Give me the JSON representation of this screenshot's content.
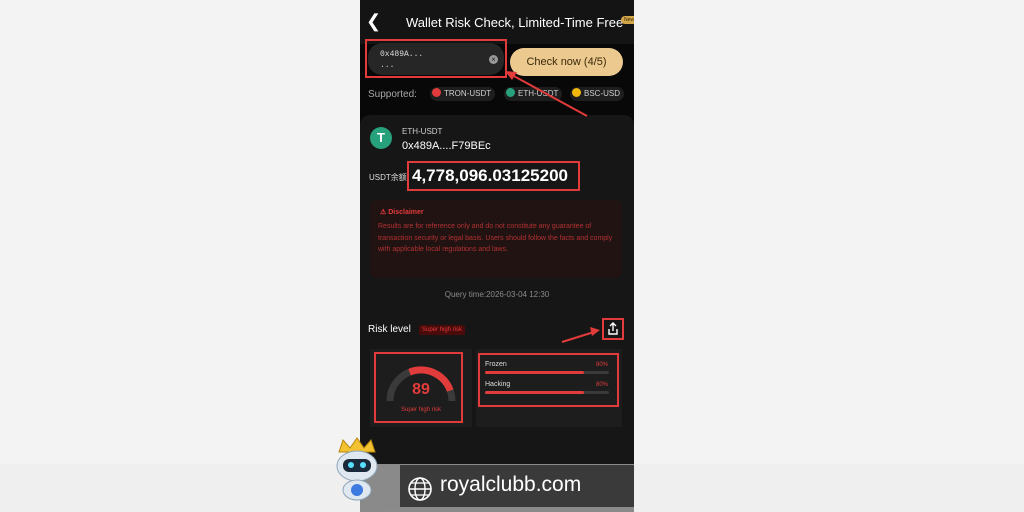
{
  "header": {
    "title": "Wallet Risk Check, Limited-Time Free",
    "badge": "New",
    "back_icon": "chevron-left-icon"
  },
  "search": {
    "address_line1": "0x489A...",
    "address_line2": "...",
    "check_label": "Check now (4/5)"
  },
  "supported": {
    "label": "Supported:",
    "chains": [
      {
        "label": "TRON-USDT",
        "color": "#e23b3b"
      },
      {
        "label": "ETH-USDT",
        "color": "#26a17b"
      },
      {
        "label": "BSC-USD",
        "color": "#f0b90b"
      }
    ]
  },
  "token": {
    "name": "ETH-USDT",
    "address": "0x489A....F79BEc",
    "balance_label": "USDT余额",
    "balance": "4,778,096.03125200"
  },
  "disclaimer": {
    "title": "Disclaimer",
    "body": "Results are for reference only and do not constitute any guarantee of transaction security or legal basis. Users should follow the facts and comply with applicable local regulations and laws."
  },
  "query_time": "Query time:2026-03-04 12:30",
  "risk": {
    "title": "Risk level",
    "tag": "Super high risk",
    "score": "89",
    "score_fraction": 0.89,
    "score_label": "Super high risk",
    "factors": [
      {
        "label": "Frozen",
        "pct": "80%",
        "value": 0.8
      },
      {
        "label": "Hacking",
        "pct": "80%",
        "value": 0.8
      }
    ]
  },
  "watermark": {
    "text": "royalclubb.com"
  },
  "colors": {
    "accent_red": "#e23b3b",
    "gold": "#ecc98f",
    "tether_green": "#26a17b"
  }
}
